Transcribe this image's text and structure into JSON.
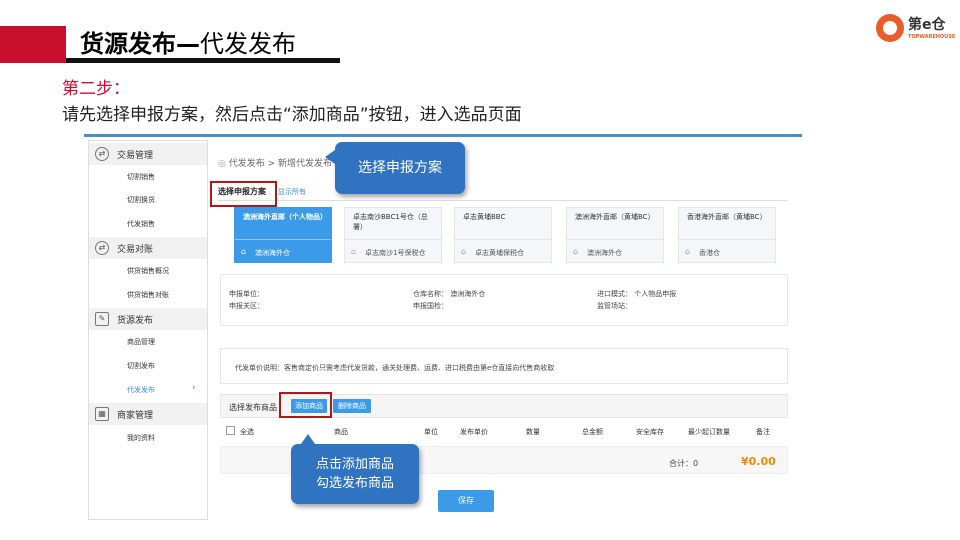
{
  "slide": {
    "title_bold": "货源发布—",
    "title_rest": "代发发布",
    "step_label": "第二步：",
    "step_desc": "请先选择申报方案，然后点击“添加商品”按钮，进入选品页面"
  },
  "logo": {
    "text": "第e仓",
    "sub": "TOPWAREHOUSE"
  },
  "sidebar": {
    "groups": [
      {
        "label": "交易管理",
        "icon": "cycle-icon",
        "glyph": "⇄",
        "items": [
          "切割销售",
          "切割换货",
          "代发销售"
        ]
      },
      {
        "label": "交易对账",
        "icon": "cycle-icon",
        "glyph": "⇄",
        "items": [
          "供货销售概况",
          "供货销售对账"
        ]
      },
      {
        "label": "货源发布",
        "icon": "edit-icon",
        "glyph": "✎",
        "items": [
          "商品管理",
          "切割发布",
          "代发发布"
        ]
      },
      {
        "label": "商家管理",
        "icon": "store-icon",
        "glyph": "▦",
        "items": [
          "我的资料"
        ]
      }
    ],
    "active_item": "代发发布",
    "chevron": "›"
  },
  "content": {
    "breadcrumb": "代发发布 > 新增代发发布",
    "pin_icon": "location-pin-icon",
    "tab_label": "选择申报方案",
    "show_all": "显示所有",
    "plans": [
      {
        "name": "澳洲海外直邮（个人物品）",
        "warehouse": "澳洲海外仓",
        "active": true
      },
      {
        "name": "卓志南沙BBC1号仓（总署）",
        "warehouse": "卓志南沙1号保税仓",
        "active": false
      },
      {
        "name": "卓志黄埔BBC",
        "warehouse": "卓志黄埔保税仓",
        "active": false
      },
      {
        "name": "澳洲海外直邮（黄埔BC）",
        "warehouse": "澳洲海外仓",
        "active": false
      },
      {
        "name": "香港海外直邮（黄埔BC）",
        "warehouse": "香港仓",
        "active": false
      }
    ],
    "info": {
      "decl_unit": "申报单位：",
      "decl_customs": "申报关区：",
      "warehouse_name": "仓库名称：  澳洲海外仓",
      "decl_inspection": "申报国检：",
      "import_mode": "进口模式：  个人物品申报",
      "supervision_site": "监管场站："
    },
    "note": "代发单价说明：客售商定价只需考虑代发货款，通关处理费、运费、进口税费由第e仓直接向代售商收取",
    "select_products_label": "选择发布商品",
    "add_button": "添加商品",
    "delete_button": "删除商品",
    "table_headers": [
      "全选",
      "商品",
      "单位",
      "发布单价",
      "数量",
      "总金额",
      "安全库存",
      "最少起订数量",
      "备注"
    ],
    "total_label": "合计：0",
    "total_amount": "¥0.00",
    "save_button": "保存"
  },
  "annotations": {
    "callout_plan": "选择申报方案",
    "callout_add_line1": "点击添加商品",
    "callout_add_line2": "勾选发布商品"
  },
  "colors": {
    "accent_red": "#c8102e",
    "app_blue": "#3c9be8",
    "callout_blue": "#2f73c1",
    "amount_orange": "#f08a00"
  }
}
